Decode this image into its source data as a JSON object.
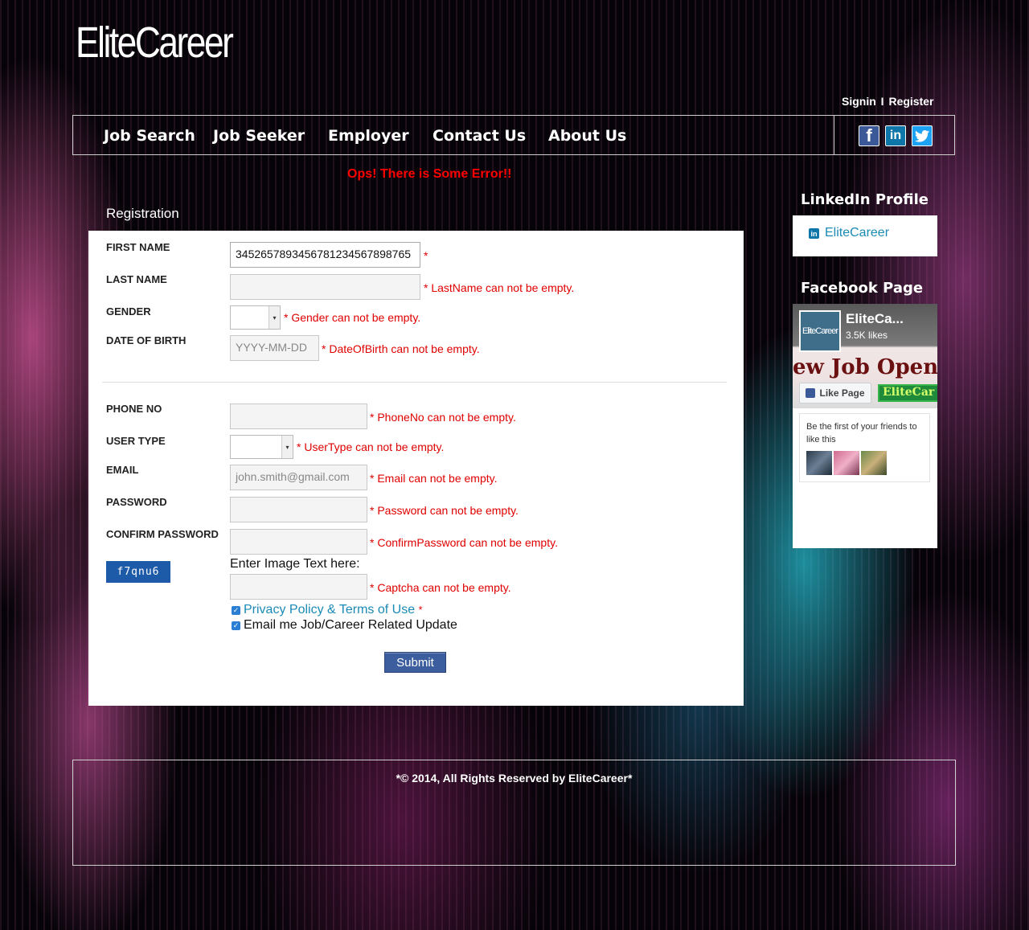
{
  "header": {
    "logo": "EliteCareer",
    "signin": "Signin",
    "separator": "I",
    "register": "Register"
  },
  "nav": {
    "items": [
      "Job Search",
      "Job Seeker",
      "Employer",
      "Contact Us",
      "About Us"
    ]
  },
  "social": {
    "facebook": "f",
    "linkedin": "in",
    "twitter": "t"
  },
  "error_banner": "Ops! There is Some Error!!",
  "form": {
    "title": "Registration",
    "first_name": {
      "label": "FIRST NAME",
      "value": "3452657893456781234567898765",
      "required": "*"
    },
    "last_name": {
      "label": "LAST NAME",
      "value": "",
      "error": "* LastName can not be empty."
    },
    "gender": {
      "label": "GENDER",
      "value": "",
      "error": "* Gender can not be empty."
    },
    "dob": {
      "label": "DATE OF BIRTH",
      "placeholder": "YYYY-MM-DD",
      "error": "* DateOfBirth can not be empty."
    },
    "phone": {
      "label": "PHONE NO",
      "value": "",
      "error": "* PhoneNo can not be empty."
    },
    "user_type": {
      "label": "USER TYPE",
      "value": "",
      "error": "* UserType can not be empty."
    },
    "email": {
      "label": "EMAIL",
      "placeholder": "john.smith@gmail.com",
      "error": "* Email can not be empty."
    },
    "password": {
      "label": "PASSWORD",
      "value": "",
      "error": "* Password can not be empty."
    },
    "confirm_password": {
      "label": "CONFIRM PASSWORD",
      "value": "",
      "error": "* ConfirmPassword can not be empty."
    },
    "captcha": {
      "image_text": "f7qnu6",
      "prompt": "Enter Image Text here:",
      "value": "",
      "error": "* Captcha can not be empty."
    },
    "privacy": {
      "label": "Privacy Policy & Terms of Use",
      "required": "*",
      "checked": true
    },
    "updates": {
      "label": "Email me Job/Career Related Update",
      "checked": true
    },
    "submit": "Submit"
  },
  "sidebar": {
    "linkedin_title": "LinkedIn Profile",
    "linkedin_name": "EliteCareer",
    "facebook_title": "Facebook Page",
    "fb_page_name": "EliteCa...",
    "fb_likes": "3.5K likes",
    "fb_avatar_text": "EliteCareer",
    "fb_banner": "ew Job Openi",
    "fb_like_button": "Like Page",
    "fb_brand": "EliteCar",
    "fb_friends_text": "Be the first of your friends to like this"
  },
  "footer": {
    "text": "*© 2014, All Rights Reserved by EliteCareer*"
  },
  "colors": {
    "error": "#ff0000",
    "link": "#1b8ab5",
    "submit": "#3d5e9e",
    "captcha": "#1d5aa8"
  }
}
